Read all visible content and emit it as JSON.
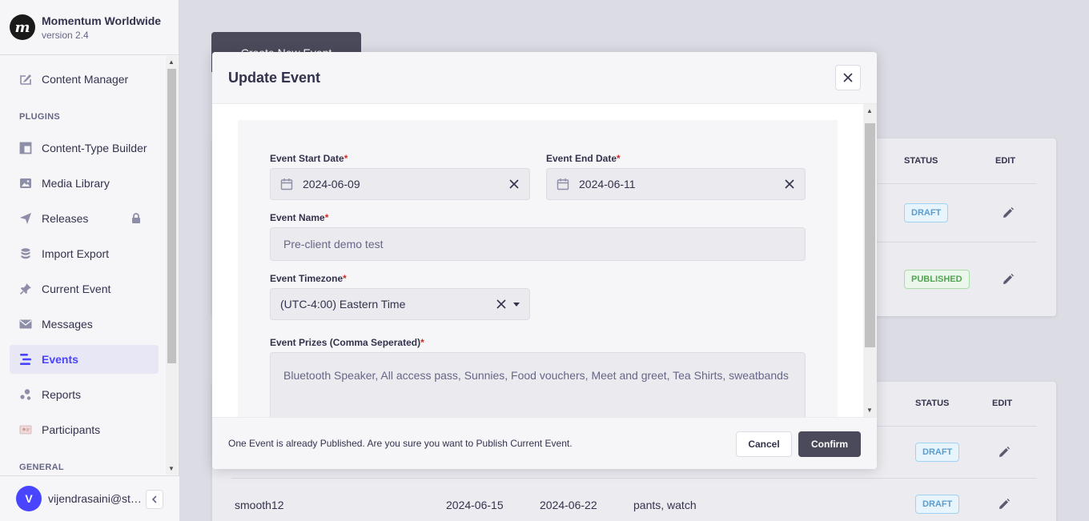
{
  "brand": {
    "logo_letter": "m",
    "name": "Momentum Worldwide",
    "version": "version 2.4"
  },
  "sidebar": {
    "content_manager": "Content Manager",
    "plugins_header": "PLUGINS",
    "items": [
      {
        "label": "Content-Type Builder",
        "icon": "layout-icon"
      },
      {
        "label": "Media Library",
        "icon": "image-icon"
      },
      {
        "label": "Releases",
        "icon": "paper-plane-icon"
      },
      {
        "label": "Import Export",
        "icon": "database-icon"
      },
      {
        "label": "Current Event",
        "icon": "pin-icon"
      },
      {
        "label": "Messages",
        "icon": "envelope-icon"
      },
      {
        "label": "Events",
        "icon": "list-icon",
        "active": true
      },
      {
        "label": "Reports",
        "icon": "chart-dots-icon"
      },
      {
        "label": "Participants",
        "icon": "id-card-icon"
      }
    ],
    "general_header": "GENERAL"
  },
  "user": {
    "initial": "V",
    "email": "vijendrasaini@staging.momentum.com"
  },
  "background": {
    "create_button": "Create New Event",
    "table1": {
      "status_header": "STATUS",
      "edit_header": "EDIT",
      "rows": [
        {
          "status": "DRAFT"
        },
        {
          "status": "PUBLISHED"
        }
      ]
    },
    "table2": {
      "status_header": "STATUS",
      "edit_header": "EDIT",
      "rows": [
        {
          "status": "DRAFT"
        },
        {
          "name": "smooth12",
          "start": "2024-06-15",
          "end": "2024-06-22",
          "prizes": "pants, watch",
          "status": "DRAFT"
        }
      ]
    }
  },
  "modal": {
    "title": "Update Event",
    "start_date": {
      "label": "Event Start Date",
      "value": "2024-06-09"
    },
    "end_date": {
      "label": "Event End Date",
      "value": "2024-06-11"
    },
    "event_name": {
      "label": "Event Name",
      "value": "Pre-client demo test"
    },
    "timezone": {
      "label": "Event Timezone",
      "value": "(UTC-4:00) Eastern Time"
    },
    "prizes": {
      "label": "Event Prizes (Comma Seperated)",
      "value": "Bluetooth Speaker, All access pass, Sunnies, Food vouchers, Meet and greet, Tea Shirts, sweatbands"
    },
    "required_mark": "*",
    "footer_message": "One Event is already Published. Are you sure you want to Publish Current Event.",
    "cancel_label": "Cancel",
    "confirm_label": "Confirm"
  },
  "colors": {
    "accent": "#4945ff",
    "required": "#d02b20",
    "draft": "#5a9ed0",
    "published": "#52a452"
  }
}
